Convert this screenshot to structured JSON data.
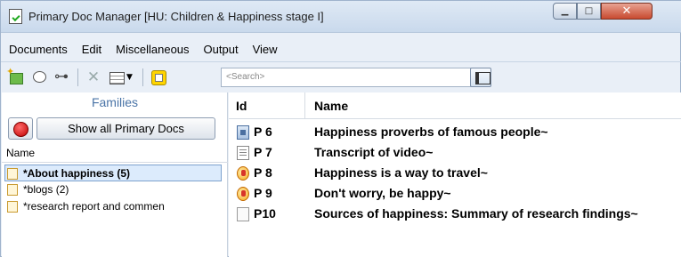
{
  "window": {
    "title": "Primary Doc Manager [HU: Children & Happiness stage I]",
    "controls": {
      "minimize": "▁",
      "maximize": "□",
      "close": "✕"
    }
  },
  "menu": [
    "Documents",
    "Edit",
    "Miscellaneous",
    "Output",
    "View"
  ],
  "toolbar": {
    "icons": [
      "new-doc-icon",
      "comment-icon",
      "connect-icon",
      "delete-icon",
      "grid-icon",
      "caret-down-icon",
      "code-icon"
    ],
    "search_placeholder": "<Search>"
  },
  "families": {
    "title": "Families",
    "show_all_label": "Show all Primary Docs",
    "column_header": "Name",
    "items": [
      {
        "label": "*About happiness (5)",
        "selected": true
      },
      {
        "label": "*blogs (2)",
        "selected": false
      },
      {
        "label": "*research report and commen",
        "selected": false
      }
    ]
  },
  "docs": {
    "columns": {
      "id": "Id",
      "name": "Name"
    },
    "rows": [
      {
        "id": "P 6",
        "name": "Happiness proverbs of famous people~",
        "icon": "video-doc-icon"
      },
      {
        "id": "P 7",
        "name": "Transcript of video~",
        "icon": "text-doc-icon"
      },
      {
        "id": "P 8",
        "name": "Happiness is a way to travel~",
        "icon": "audio-doc-icon"
      },
      {
        "id": "P 9",
        "name": "Don't worry, be happy~",
        "icon": "audio-doc-icon"
      },
      {
        "id": "P10",
        "name": "Sources of happiness: Summary of research findings~",
        "icon": "blank-doc-icon"
      }
    ]
  },
  "colors": {
    "families_title": "#4a74a7",
    "selection_bg": "#dcebfc",
    "close_button": "#c84a2f"
  }
}
